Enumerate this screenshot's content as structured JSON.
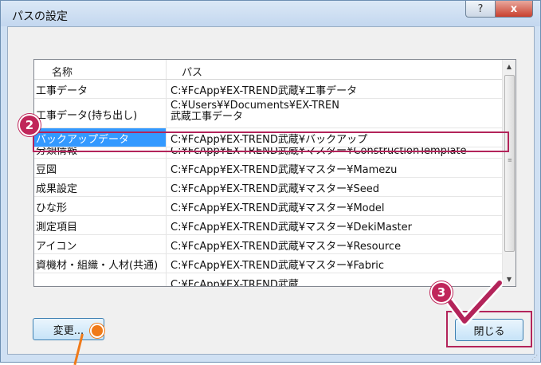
{
  "window": {
    "title": "パスの設定",
    "help_label": "?",
    "close_label": "x"
  },
  "list": {
    "columns": [
      "名称",
      "パス"
    ],
    "rows": [
      {
        "name": "工事データ",
        "path": "C:¥FcApp¥EX-TREND武蔵¥工事データ"
      },
      {
        "name": "工事データ(持ち出し)",
        "path_parts": [
          "C:¥Users¥",
          "",
          "¥Documents¥EX-TREN",
          "武蔵工事データ"
        ]
      },
      {
        "name": "バックアップデータ",
        "path": "C:¥FcApp¥EX-TREND武蔵¥バックアップ"
      },
      {
        "name": "分類情報",
        "path": "C:¥FcApp¥EX-TREND武蔵¥マスター¥ConstructionTemplate"
      },
      {
        "name": "豆図",
        "path": "C:¥FcApp¥EX-TREND武蔵¥マスター¥Mamezu"
      },
      {
        "name": "成果設定",
        "path": "C:¥FcApp¥EX-TREND武蔵¥マスター¥Seed"
      },
      {
        "name": "ひな形",
        "path": "C:¥FcApp¥EX-TREND武蔵¥マスター¥Model"
      },
      {
        "name": "測定項目",
        "path": "C:¥FcApp¥EX-TREND武蔵¥マスター¥DekiMaster"
      },
      {
        "name": "アイコン",
        "path": "C:¥FcApp¥EX-TREND武蔵¥マスター¥Resource"
      },
      {
        "name": "資機材・組織・人材(共通)",
        "path": "C:¥FcApp¥EX-TREND武蔵¥マスター¥Fabric"
      },
      {
        "name": "",
        "path": "C:¥FcApp¥EX-TREND武蔵"
      }
    ],
    "selected_index": 2
  },
  "buttons": {
    "change": "変更...",
    "close": "閉じる"
  },
  "annotations": {
    "step2": "2",
    "step3": "3"
  },
  "colors": {
    "selection": "#3399ff",
    "annotation": "#c0265a",
    "pointer": "#f07a19"
  }
}
